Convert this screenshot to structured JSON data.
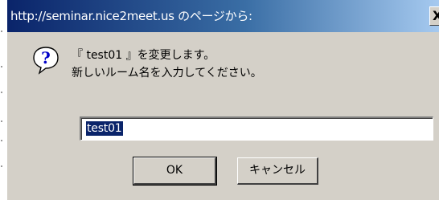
{
  "dialog": {
    "title": "http://seminar.nice2meet.us のページから:",
    "close_label": "X",
    "icon": "question-icon",
    "message_line1": "『 test01 』を変更します。",
    "message_line2": "新しいルーム名を入力してください。",
    "input_value": "test01",
    "ok_label": "OK",
    "cancel_label": "キャンセル"
  },
  "colors": {
    "title_bar_start": "#0a246a",
    "title_bar_end": "#a6caf0",
    "dialog_face": "#d4d0c8",
    "selection": "#0a246a"
  }
}
